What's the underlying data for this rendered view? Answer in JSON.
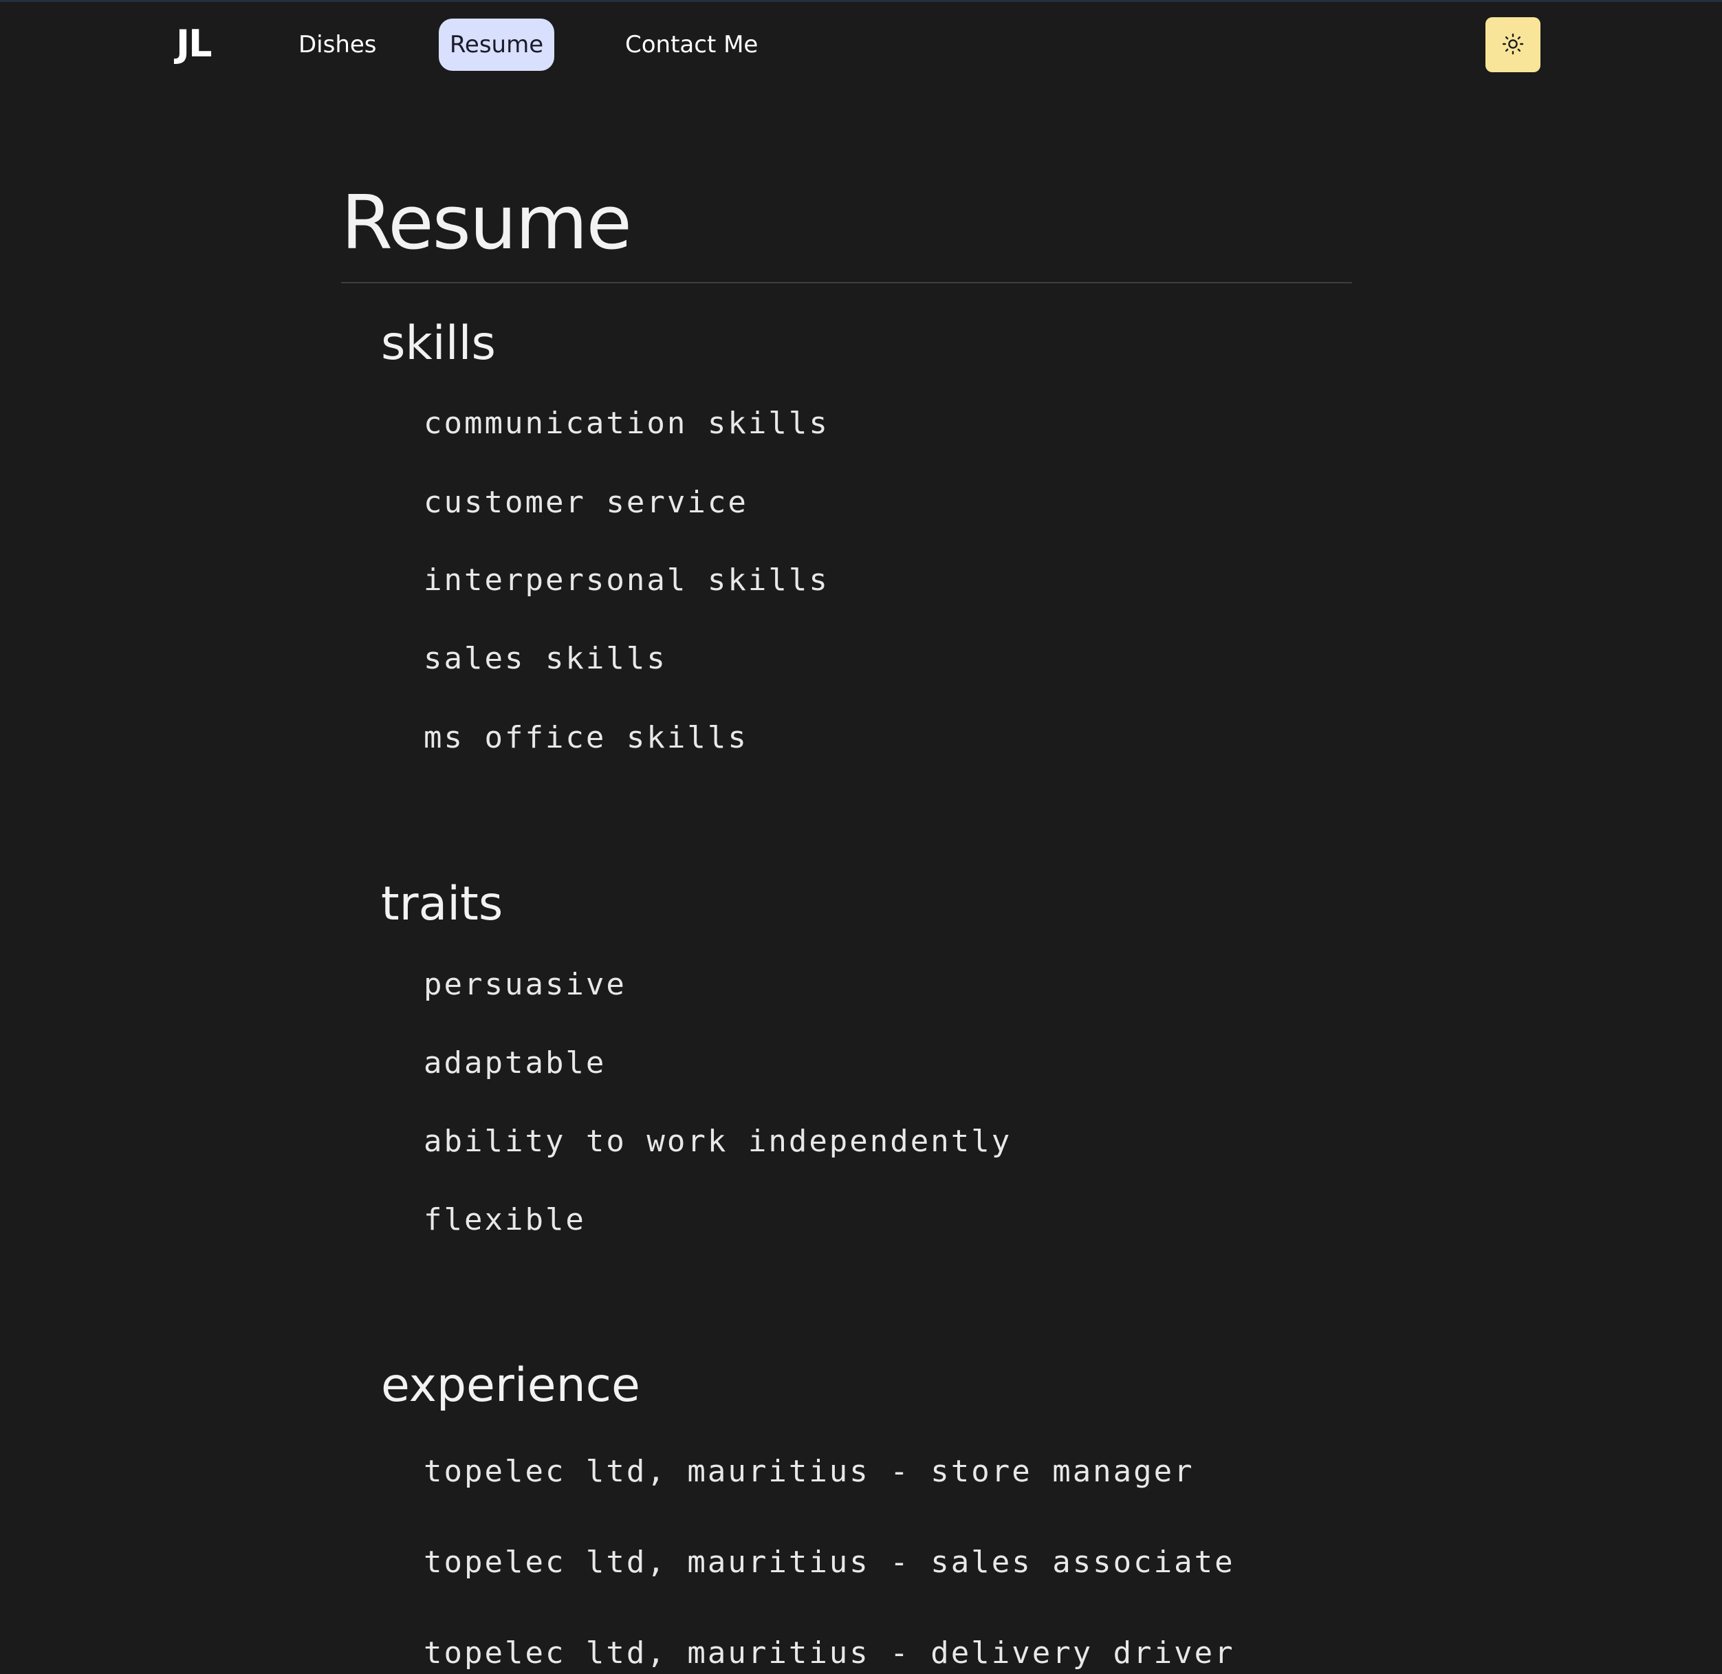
{
  "nav": {
    "logo": "JL",
    "links": [
      {
        "label": "Dishes"
      },
      {
        "label": "Resume",
        "active": true
      },
      {
        "label": "Contact Me"
      }
    ],
    "theme_toggle_icon": "sun-icon"
  },
  "page": {
    "title": "Resume"
  },
  "sections": [
    {
      "title": "skills",
      "items": [
        "communication skills",
        "customer service",
        "interpersonal skills",
        "sales skills",
        "ms office skills"
      ]
    },
    {
      "title": "traits",
      "items": [
        "persuasive",
        "adaptable",
        "ability to work independently",
        "flexible"
      ]
    },
    {
      "title": "experience",
      "items": [
        "topelec ltd, mauritius - store manager",
        "topelec ltd, mauritius - sales associate",
        "topelec ltd, mauritius - delivery driver"
      ]
    }
  ],
  "colors": {
    "background": "#1b1b1b",
    "active_tab": "#d8e0fe",
    "theme_button": "#f8e59a"
  }
}
